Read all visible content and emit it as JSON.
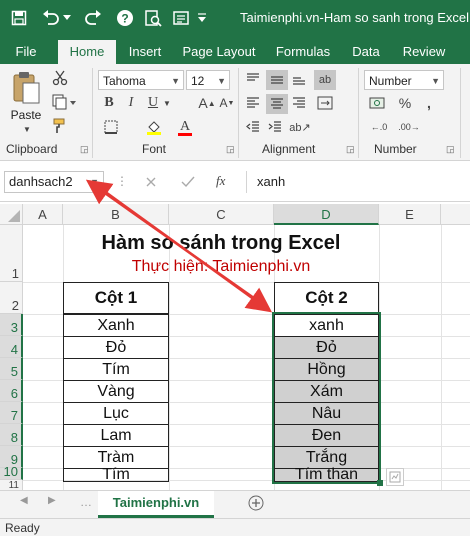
{
  "app": {
    "title": "Taimienphi.vn-Ham so sanh trong Excel.xls",
    "brand_color": "#217346"
  },
  "tabs": [
    "File",
    "Home",
    "Insert",
    "Page Layout",
    "Formulas",
    "Data",
    "Review"
  ],
  "active_tab": "Home",
  "ribbon": {
    "paste_label": "Paste",
    "font_name": "Tahoma",
    "font_size": "12",
    "number_format": "Number",
    "group_labels": [
      "Clipboard",
      "Font",
      "Alignment",
      "Number"
    ]
  },
  "formula_bar": {
    "name_box": "danhsach2",
    "fx_label": "fx",
    "value": "xanh"
  },
  "columns": [
    "A",
    "B",
    "C",
    "D",
    "E"
  ],
  "selected_column": "D",
  "rows": [
    "1",
    "2",
    "3",
    "4",
    "5",
    "6",
    "7",
    "8",
    "9",
    "10",
    "11"
  ],
  "sheet": {
    "title": "Hàm so sánh trong Excel",
    "subtitle": "Thực hiện: Taimienphi.vn",
    "subtitle_color": "#c00000",
    "col1_header": "Cột 1",
    "col2_header": "Cột 2",
    "col1_values": [
      "Xanh",
      "Đỏ",
      "Tím",
      "Vàng",
      "Lục",
      "Lam",
      "Tràm",
      "Tím"
    ],
    "col2_values": [
      "xanh",
      "Đỏ",
      "Hồng",
      "Xám",
      "Nâu",
      "Đen",
      "Trắng",
      "Tím than"
    ]
  },
  "sheet_tab": "Taimienphi.vn",
  "status": "Ready"
}
